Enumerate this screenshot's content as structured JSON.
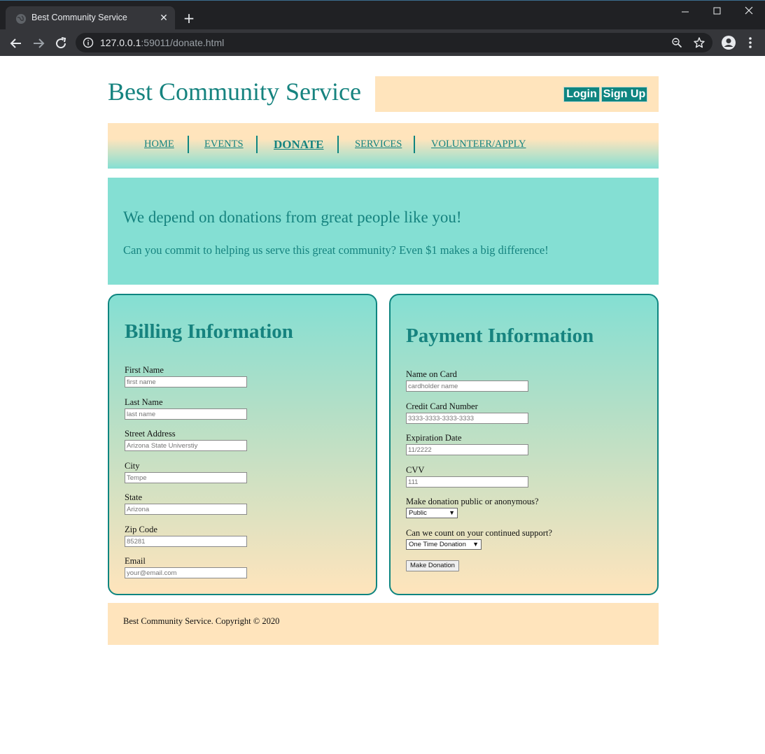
{
  "browser": {
    "tab_title": "Best Community Service",
    "url_host": "127.0.0.1",
    "url_rest": ":59011/donate.html"
  },
  "header": {
    "site_title": "Best Community Service",
    "login_label": "Login",
    "signup_label": "Sign Up"
  },
  "nav": {
    "items": [
      {
        "label": "HOME"
      },
      {
        "label": "EVENTS"
      },
      {
        "label": "DONATE",
        "active": true
      },
      {
        "label": "SERVICES"
      },
      {
        "label": "VOLUNTEER/APPLY"
      }
    ]
  },
  "hero": {
    "title": "We depend on donations from great people like you!",
    "subtitle": "Can you commit to helping us serve this great community? Even $1 makes a big difference!"
  },
  "billing": {
    "title": "Billing Information",
    "fields": [
      {
        "label": "First Name",
        "placeholder": "first name"
      },
      {
        "label": "Last Name",
        "placeholder": "last name"
      },
      {
        "label": "Street Address",
        "placeholder": "Arizona State Universtiy"
      },
      {
        "label": "City",
        "placeholder": "Tempe"
      },
      {
        "label": "State",
        "placeholder": "Arizona"
      },
      {
        "label": "Zip Code",
        "placeholder": "85281"
      },
      {
        "label": "Email",
        "placeholder": "your@email.com"
      }
    ]
  },
  "payment": {
    "title": "Payment Information",
    "fields": [
      {
        "label": "Name on Card",
        "placeholder": "cardholder name"
      },
      {
        "label": "Credit Card Number",
        "placeholder": "3333-3333-3333-3333"
      },
      {
        "label": "Expiration Date",
        "placeholder": "11/2222"
      },
      {
        "label": "CVV",
        "placeholder": "111"
      }
    ],
    "visibility_label": "Make donation public or anonymous?",
    "visibility_value": "Public",
    "frequency_label": "Can we count on your continued support?",
    "frequency_value": "One Time Donation",
    "submit_label": "Make Donation"
  },
  "footer": {
    "text": "Best Community Service. Copyright © 2020"
  },
  "colors": {
    "accent": "#16837f",
    "cream": "#ffe4bc",
    "mint": "#84dfd3"
  }
}
